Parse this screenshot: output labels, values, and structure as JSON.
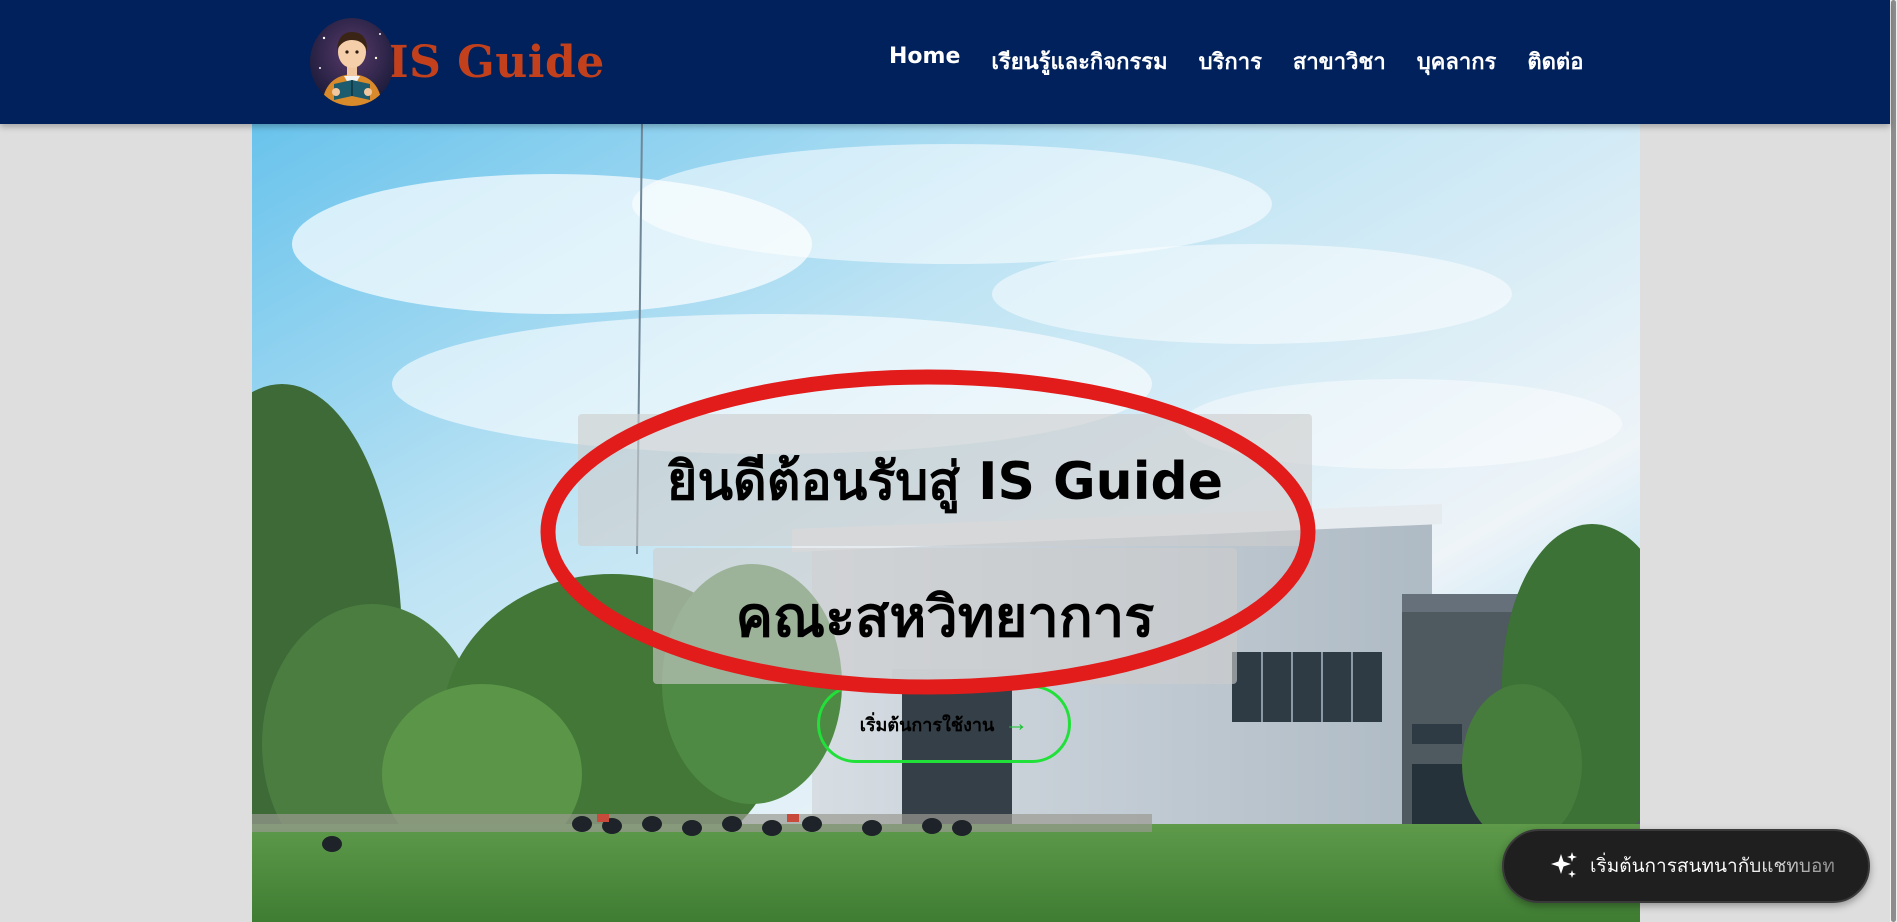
{
  "brand": {
    "name": "IS Guide",
    "logo_icon": "reading-student-avatar",
    "color": "#c2411c"
  },
  "nav": {
    "background": "#00215c",
    "items": [
      {
        "label": "Home"
      },
      {
        "label": "เรียนรู้และกิจกรรม"
      },
      {
        "label": "บริการ"
      },
      {
        "label": "สาขาวิชา"
      },
      {
        "label": "บุคลากร"
      },
      {
        "label": "ติดต่อ"
      }
    ]
  },
  "hero": {
    "image_icon": "faculty-building-photo",
    "welcome_title": "ยินดีต้อนรับสู่ IS Guide",
    "faculty_title": "คณะสหวิทยาการ",
    "start_button_label": "เริ่มต้นการใช้งาน",
    "start_button_icon": "arrow-right-icon",
    "start_button_color": "#22e03a",
    "annotation_color": "#e21b1b"
  },
  "chatbot": {
    "label": "เริ่มต้นการสนทนากับแชทบอท",
    "icon": "sparkle-icon"
  }
}
